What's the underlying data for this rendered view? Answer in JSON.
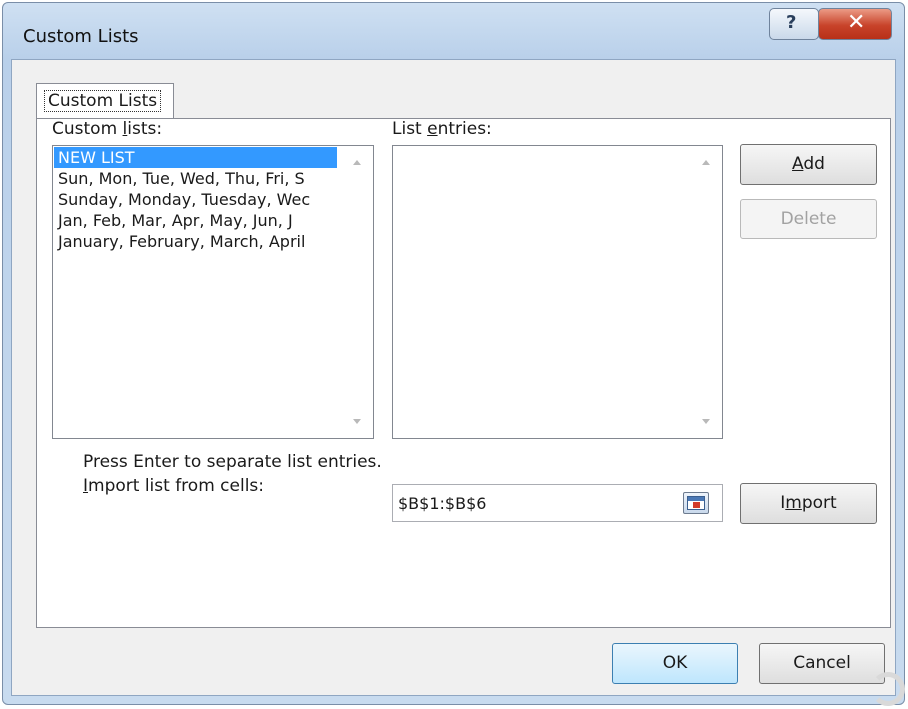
{
  "window": {
    "title": "Custom Lists",
    "help_glyph": "?",
    "close_glyph": "✕"
  },
  "tab": {
    "label": "Custom Lists"
  },
  "custom_lists": {
    "label_pre": "Custom ",
    "label_accel": "l",
    "label_post": "ists:",
    "items": [
      "NEW LIST",
      "Sun, Mon, Tue, Wed, Thu, Fri, S",
      "Sunday, Monday, Tuesday, Wec",
      "Jan, Feb, Mar, Apr, May, Jun, J",
      "January, February, March, April"
    ],
    "selected_index": 0
  },
  "list_entries": {
    "label_pre": "List ",
    "label_accel": "e",
    "label_post": "ntries:",
    "value": ""
  },
  "buttons": {
    "add_accel": "A",
    "add_rest": "dd",
    "delete": "Delete",
    "import_pre": "I",
    "import_accel": "m",
    "import_post": "port",
    "ok": "OK",
    "cancel": "Cancel"
  },
  "hints": {
    "separator_hint": "Press Enter to separate list entries.",
    "import_label_accel": "I",
    "import_label_rest": "mport list from cells:"
  },
  "import_field": {
    "value": "$B$1:$B$6"
  },
  "colors": {
    "selection": "#3399ff",
    "close_button": "#c8432a",
    "title_bar": "#c8dbef"
  },
  "icons": {
    "help": "help-icon",
    "close": "close-icon",
    "collapse": "collapse-dialog-icon",
    "scroll_up": "scroll-up-arrow-icon",
    "scroll_down": "scroll-down-arrow-icon"
  }
}
